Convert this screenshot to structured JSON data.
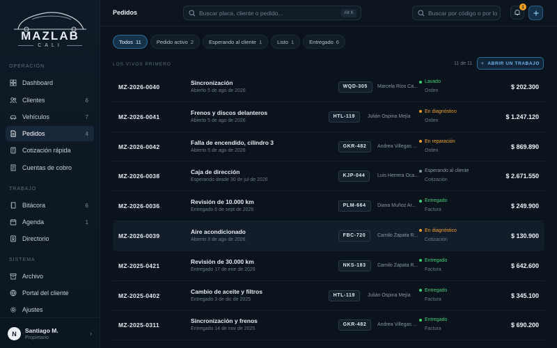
{
  "brand": {
    "name": "MAZLAB",
    "sub": "CALI"
  },
  "sidebar": {
    "sections": [
      {
        "label": "OPERACIÓN",
        "items": [
          {
            "label": "Dashboard",
            "icon": "dashboard-icon",
            "count": ""
          },
          {
            "label": "Clientes",
            "icon": "users-icon",
            "count": "6"
          },
          {
            "label": "Vehículos",
            "icon": "car-icon",
            "count": "7"
          },
          {
            "label": "Pedidos",
            "icon": "document-icon",
            "count": "4",
            "active": true
          },
          {
            "label": "Cotización rápida",
            "icon": "calculator-icon",
            "count": ""
          },
          {
            "label": "Cuentas de cobro",
            "icon": "receipt-icon",
            "count": ""
          }
        ]
      },
      {
        "label": "TRABAJO",
        "items": [
          {
            "label": "Bitácora",
            "icon": "notebook-icon",
            "count": "6"
          },
          {
            "label": "Agenda",
            "icon": "calendar-icon",
            "count": "1"
          },
          {
            "label": "Directorio",
            "icon": "contacts-icon",
            "count": ""
          }
        ]
      },
      {
        "label": "SISTEMA",
        "items": [
          {
            "label": "Archivo",
            "icon": "archive-icon",
            "count": ""
          },
          {
            "label": "Portal del cliente",
            "icon": "globe-icon",
            "count": ""
          },
          {
            "label": "Ajustes",
            "icon": "gear-icon",
            "count": ""
          }
        ]
      }
    ],
    "user": {
      "initial": "N",
      "name": "Santiago M.",
      "role": "Propietario"
    }
  },
  "topbar": {
    "title": "Pedidos",
    "search_placeholder": "Buscar placa, cliente o pedido...",
    "search_kbd": "Alt K",
    "code_search_placeholder": "Buscar por código o por lo",
    "notifications": "1"
  },
  "filters": [
    {
      "label": "Todos",
      "count": "11",
      "active": true
    },
    {
      "label": "Pedido activo",
      "count": "2"
    },
    {
      "label": "Esperando al cliente",
      "count": "1"
    },
    {
      "label": "Listo",
      "count": "1"
    },
    {
      "label": "Entregado",
      "count": "6"
    }
  ],
  "list": {
    "caption": "LOS VIVOS PRIMERO",
    "count_text": "11 de 11",
    "new_button": "ABRIR UN TRABAJO",
    "status_colors": {
      "green": "#3fcf7a",
      "orange": "#f0a030",
      "gray": "#8a98a6"
    },
    "rows": [
      {
        "code": "MZ-2026-0040",
        "title": "Sincronización",
        "sub": "Abierto 5 de ago de 2026",
        "plate": "WQD-305",
        "client": "Marcela Ríos Ca...",
        "status": "Lavado",
        "status_color": "green",
        "stype": "Orden",
        "amount": "$ 202.300"
      },
      {
        "code": "MZ-2026-0041",
        "title": "Frenos y discos delanteros",
        "sub": "Abierto 5 de ago de 2026",
        "plate": "HTL-119",
        "client": "Julián Ospina Mejía",
        "status": "En diagnóstico",
        "status_color": "orange",
        "stype": "Orden",
        "amount": "$ 1.247.120"
      },
      {
        "code": "MZ-2026-0042",
        "title": "Falla de encendido, cilindro 3",
        "sub": "Abierto 5 de ago de 2026",
        "plate": "GKR-482",
        "client": "Andrea Villegas ...",
        "status": "En reparación",
        "status_color": "orange",
        "stype": "Orden",
        "amount": "$ 869.890"
      },
      {
        "code": "MZ-2026-0038",
        "title": "Caja de dirección",
        "sub": "Esperando desde 30 de jul de 2026",
        "plate": "KJP-044",
        "client": "Luis Herrera Oca...",
        "status": "Esperando al cliente",
        "status_color": "gray",
        "stype": "Cotización",
        "amount": "$ 2.671.550"
      },
      {
        "code": "MZ-2026-0036",
        "title": "Revisión de 10.000 km",
        "sub": "Entregado 6 de sept de 2026",
        "plate": "PLM-664",
        "client": "Diana Muñoz Ar...",
        "status": "Entregado",
        "status_color": "green",
        "stype": "Factura",
        "amount": "$ 249.900"
      },
      {
        "code": "MZ-2026-0039",
        "title": "Aire acondicionado",
        "sub": "Abierto 3 de ago de 2026",
        "plate": "FBC-720",
        "client": "Camilo Zapata R...",
        "status": "En diagnóstico",
        "status_color": "orange",
        "stype": "Cotización",
        "amount": "$ 130.900",
        "highlight": true
      },
      {
        "code": "MZ-2025-0421",
        "title": "Revisión de 30.000 km",
        "sub": "Entregado 17 de ene de 2026",
        "plate": "NKS-183",
        "client": "Camilo Zapata R...",
        "status": "Entregado",
        "status_color": "green",
        "stype": "Factura",
        "amount": "$ 642.600"
      },
      {
        "code": "MZ-2025-0402",
        "title": "Cambio de aceite y filtros",
        "sub": "Entregado 3 de dic de 2025",
        "plate": "HTL-119",
        "client": "Julián Ospina Mejía",
        "status": "Entregado",
        "status_color": "green",
        "stype": "Factura",
        "amount": "$ 345.100"
      },
      {
        "code": "MZ-2025-0311",
        "title": "Sincronización y frenos",
        "sub": "Entregado 14 de nov de 2025",
        "plate": "GKR-482",
        "client": "Andrea Villegas ...",
        "status": "Entregado",
        "status_color": "green",
        "stype": "Factura",
        "amount": "$ 690.200"
      }
    ]
  }
}
